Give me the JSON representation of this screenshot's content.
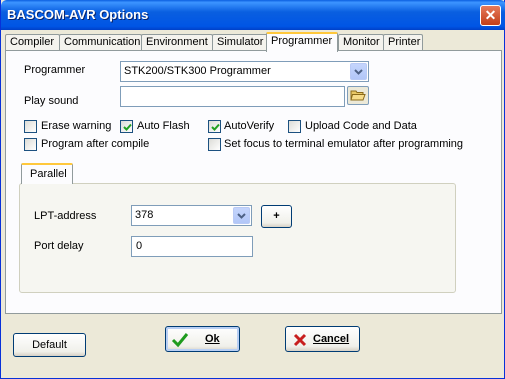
{
  "window": {
    "title": "BASCOM-AVR Options",
    "close_label": "✕"
  },
  "tabs": [
    {
      "label": "Compiler"
    },
    {
      "label": "Communication"
    },
    {
      "label": "Environment"
    },
    {
      "label": "Simulator"
    },
    {
      "label": "Programmer"
    },
    {
      "label": "Monitor"
    },
    {
      "label": "Printer"
    }
  ],
  "active_tab": "Programmer",
  "programmer": {
    "label": "Programmer",
    "value": "STK200/STK300 Programmer"
  },
  "play_sound": {
    "label": "Play sound",
    "value": ""
  },
  "options": [
    {
      "label": "Erase warning",
      "checked": false
    },
    {
      "label": "Auto Flash",
      "checked": true
    },
    {
      "label": "AutoVerify",
      "checked": true
    },
    {
      "label": "Upload Code and Data",
      "checked": false
    },
    {
      "label": "Program after compile",
      "checked": false
    },
    {
      "label": "Set focus to terminal emulator after programming",
      "checked": false
    }
  ],
  "parallel": {
    "tab_label": "Parallel",
    "lpt_label": "LPT-address",
    "lpt_value": "378",
    "plus_label": "+",
    "delay_label": "Port delay",
    "delay_value": "0"
  },
  "buttons": {
    "default": "Default",
    "ok": "Ok",
    "cancel": "Cancel"
  },
  "colors": {
    "ok_check": "#1E9B1E",
    "cancel_x": "#C81E1E",
    "active_tab_accent": "#FFC83C"
  }
}
